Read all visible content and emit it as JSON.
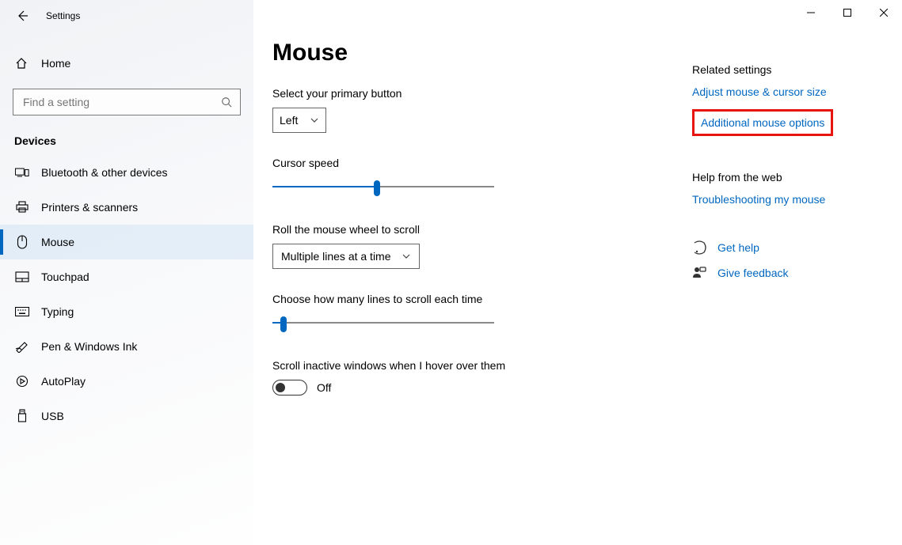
{
  "window": {
    "title": "Settings"
  },
  "sidebar": {
    "home_label": "Home",
    "search_placeholder": "Find a setting",
    "category": "Devices",
    "items": [
      {
        "label": "Bluetooth & other devices"
      },
      {
        "label": "Printers & scanners"
      },
      {
        "label": "Mouse"
      },
      {
        "label": "Touchpad"
      },
      {
        "label": "Typing"
      },
      {
        "label": "Pen & Windows Ink"
      },
      {
        "label": "AutoPlay"
      },
      {
        "label": "USB"
      }
    ],
    "active_index": 2
  },
  "page": {
    "title": "Mouse",
    "primary_button": {
      "label": "Select your primary button",
      "value": "Left"
    },
    "cursor_speed": {
      "label": "Cursor speed",
      "value_percent": 47
    },
    "wheel_mode": {
      "label": "Roll the mouse wheel to scroll",
      "value": "Multiple lines at a time"
    },
    "lines": {
      "label": "Choose how many lines to scroll each time",
      "value_percent": 5
    },
    "inactive": {
      "label": "Scroll inactive windows when I hover over them",
      "state_label": "Off"
    }
  },
  "aside": {
    "related_heading": "Related settings",
    "link_adjust": "Adjust mouse & cursor size",
    "link_additional": "Additional mouse options",
    "help_heading": "Help from the web",
    "link_troubleshoot": "Troubleshooting my mouse",
    "get_help": "Get help",
    "feedback": "Give feedback"
  }
}
